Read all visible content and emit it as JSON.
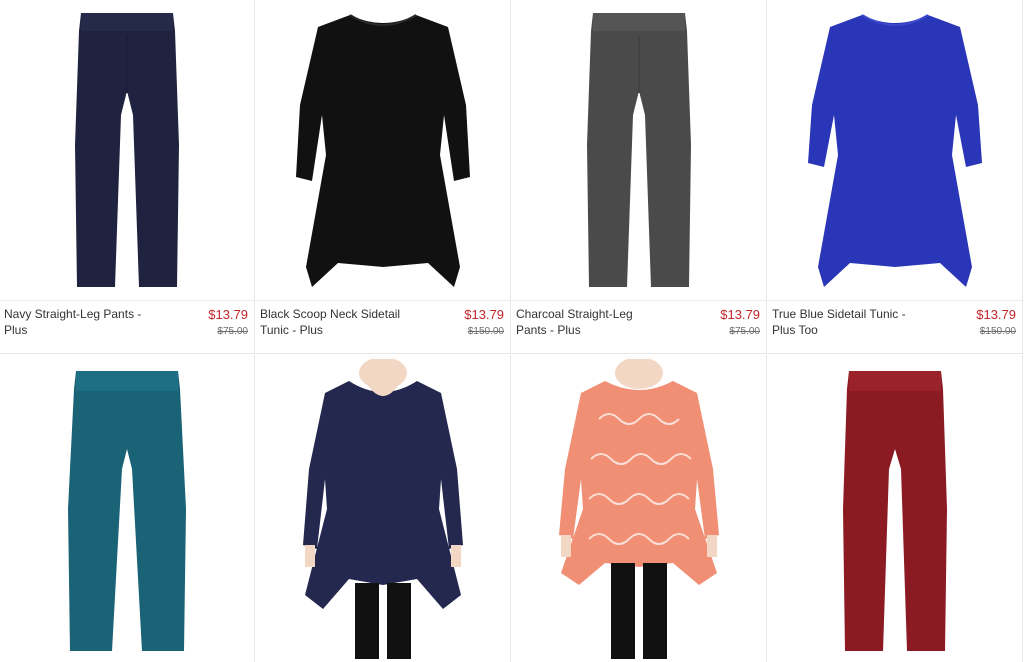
{
  "products": [
    {
      "name": "Navy Straight-Leg Pants - Plus",
      "price": "$13.79",
      "original_price": "$75.00",
      "color": "#1f2340",
      "kind": "pants"
    },
    {
      "name": "Black Scoop Neck Sidetail Tunic - Plus",
      "price": "$13.79",
      "original_price": "$150.00",
      "color": "#111111",
      "kind": "tunic"
    },
    {
      "name": "Charcoal Straight-Leg Pants - Plus",
      "price": "$13.79",
      "original_price": "$75.00",
      "color": "#4a4a4a",
      "kind": "pants"
    },
    {
      "name": "True Blue Sidetail Tunic - Plus Too",
      "price": "$13.79",
      "original_price": "$150.00",
      "color": "#2a36b8",
      "kind": "tunic"
    },
    {
      "color": "#1a6376",
      "kind": "pants"
    },
    {
      "color": "#24284f",
      "kind": "tunic-model"
    },
    {
      "color": "#f08f73",
      "kind": "tunic-model-print"
    },
    {
      "color": "#8b1a22",
      "kind": "pants"
    }
  ]
}
